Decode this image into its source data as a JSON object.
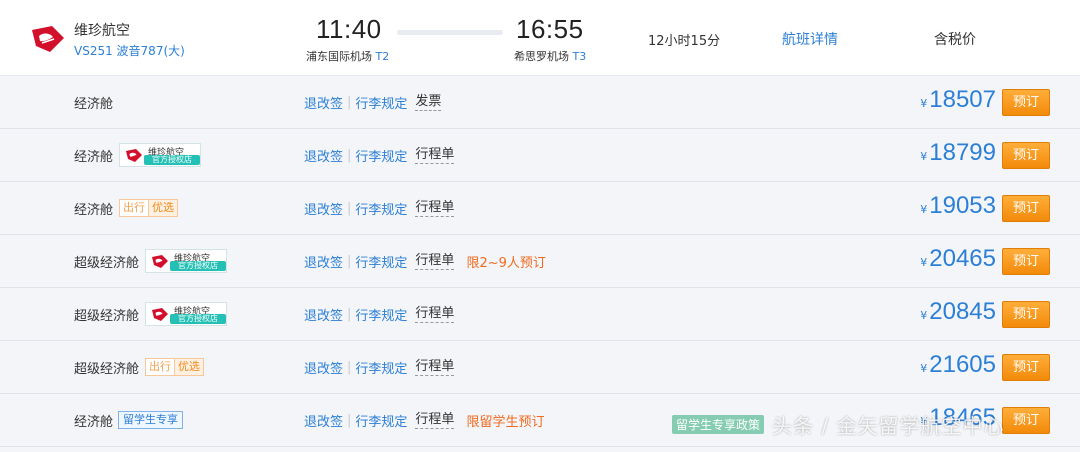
{
  "flight": {
    "airline_name": "维珍航空",
    "flight_number": "VS251 波音787(大)",
    "dep_time": "11:40",
    "dep_airport": "浦东国际机场",
    "dep_terminal": "T2",
    "arr_time": "16:55",
    "arr_airport": "希思罗机场",
    "arr_terminal": "T3",
    "duration": "12小时15分",
    "detail_link": "航班详情",
    "price_label": "含税价"
  },
  "badges": {
    "airline_top": "维珍航空",
    "airline_bottom": "官方授权店",
    "youxuan_1": "出行",
    "youxuan_2": "优选",
    "student": "留学生专享"
  },
  "links": {
    "refund": "退改签",
    "baggage": "行李规定"
  },
  "currency": "¥",
  "book_label": "预订",
  "fares": [
    {
      "cabin": "经济舱",
      "doc": "发票",
      "note": "",
      "price": "18507"
    },
    {
      "cabin": "经济舱",
      "doc": "行程单",
      "note": "",
      "price": "18799"
    },
    {
      "cabin": "经济舱",
      "doc": "行程单",
      "note": "",
      "price": "19053"
    },
    {
      "cabin": "超级经济舱",
      "doc": "行程单",
      "note": "限2~9人预订",
      "price": "20465"
    },
    {
      "cabin": "超级经济舱",
      "doc": "行程单",
      "note": "",
      "price": "20845"
    },
    {
      "cabin": "超级经济舱",
      "doc": "行程单",
      "note": "",
      "price": "21605"
    },
    {
      "cabin": "经济舱",
      "doc": "行程单",
      "note": "限留学生预订",
      "price": "18465"
    }
  ],
  "watermark": {
    "tag": "留学生专享政策",
    "text": "头条 / 金矢留学航空中心"
  },
  "colors": {
    "accent_blue": "#2c7fd6",
    "book_orange": "#f28a0a",
    "note_orange": "#f06a1f"
  }
}
